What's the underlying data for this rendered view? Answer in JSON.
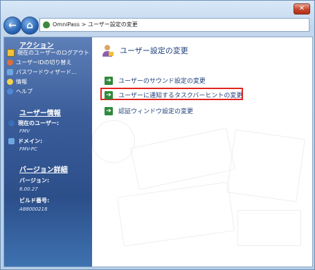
{
  "window": {
    "close_label": "✕",
    "breadcrumb": "OmniPass > ユーザー設定の変更"
  },
  "sidebar": {
    "actions_title": "アクション",
    "actions": [
      {
        "label": "現在のユーザーのログアウト",
        "icon": "logout-icon"
      },
      {
        "label": "ユーザーIDの切り替え",
        "icon": "switch-user-icon"
      },
      {
        "label": "パスワードウィザード...",
        "icon": "password-wizard-icon"
      },
      {
        "label": "情報",
        "icon": "info-icon"
      },
      {
        "label": "ヘルプ",
        "icon": "help-icon"
      }
    ],
    "user_info_title": "ユーザー情報",
    "current_user_label": "現在のユーザー:",
    "current_user_value": "FMV",
    "domain_label": "ドメイン:",
    "domain_value": "FMV-PC",
    "version_title": "バージョン詳細",
    "version_label": "バージョン:",
    "version_value": "6.00.27",
    "build_label": "ビルド番号:",
    "build_value": "A88000218"
  },
  "main": {
    "title": "ユーザー設定の変更",
    "tasks": [
      {
        "label": "ユーザーのサウンド設定の変更"
      },
      {
        "label": "ユーザーに通知するタスクバーヒントの変更"
      },
      {
        "label": "認証ウィンドウ設定の変更"
      }
    ],
    "highlight_color": "#e0231c"
  }
}
